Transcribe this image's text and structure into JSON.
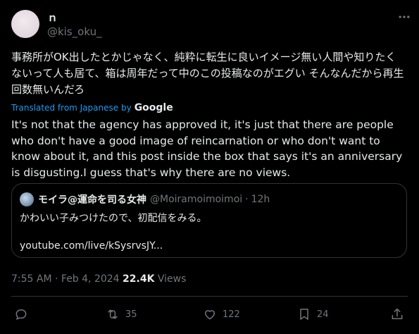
{
  "author": {
    "display_name": "ｎ",
    "handle": "@kis_oku_"
  },
  "tweet": {
    "original_text": "事務所がOK出したとかじゃなく、純粋に転生に良いイメージ無い人間や知りたくないって人も居て、箱は周年だって中のこの投稿なのがエグい そんなんだから再生回数無いんだろ",
    "translated_label": "Translated from Japanese by",
    "translator": "Google",
    "translated_text": "It's not that the agency has approved it, it's just that there are people who don't have a good image of reincarnation or who don't want to know about it, and this post inside the box that says it's an anniversary is disgusting.I guess that's why there are no views."
  },
  "quoted_tweet": {
    "name": "モイラ@運命を司る女神",
    "handle": "@Moiramoimoimoi",
    "separator": "·",
    "time": "12h",
    "text": "かわいい子みつけたので、初配信をみる。",
    "link": "youtube.com/live/kSysrvsJY..."
  },
  "meta": {
    "time": "7:55 AM",
    "separator": "·",
    "date": "Feb 4, 2024",
    "views_count": "22.4K",
    "views_label": "Views"
  },
  "actions": {
    "retweets": "35",
    "likes": "122",
    "bookmarks": "24"
  },
  "colors": {
    "background": "#000000",
    "text": "#e7e9ea",
    "secondary": "#71767b",
    "link": "#1d9bf0",
    "border": "#2f3336"
  }
}
